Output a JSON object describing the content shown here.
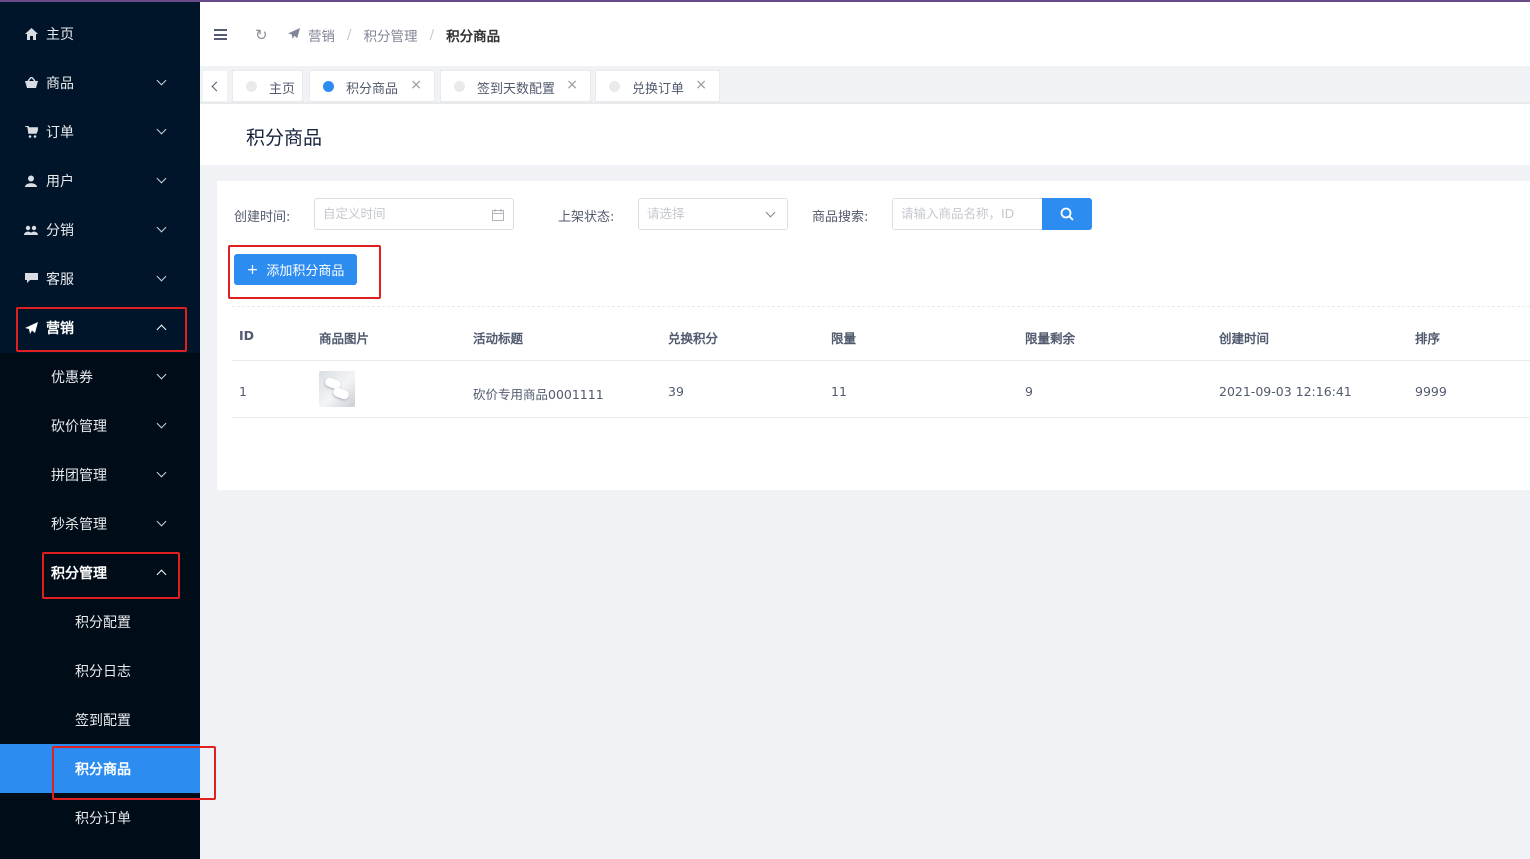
{
  "sidebar": {
    "items": [
      {
        "label": "主页",
        "icon": "home-icon",
        "has_arrow": false
      },
      {
        "label": "商品",
        "icon": "basket-icon",
        "has_arrow": true
      },
      {
        "label": "订单",
        "icon": "cart-icon",
        "has_arrow": true
      },
      {
        "label": "用户",
        "icon": "user-icon",
        "has_arrow": true
      },
      {
        "label": "分销",
        "icon": "group-icon",
        "has_arrow": true
      },
      {
        "label": "客服",
        "icon": "chat-icon",
        "has_arrow": true
      },
      {
        "label": "营销",
        "icon": "send-icon",
        "has_arrow": true,
        "expanded": true
      }
    ],
    "marketing_sub": [
      {
        "label": "优惠券"
      },
      {
        "label": "砍价管理"
      },
      {
        "label": "拼团管理"
      },
      {
        "label": "秒杀管理"
      },
      {
        "label": "积分管理",
        "expanded": true
      }
    ],
    "points_sub": [
      {
        "label": "积分配置"
      },
      {
        "label": "积分日志"
      },
      {
        "label": "签到配置"
      },
      {
        "label": "积分商品",
        "selected": true
      },
      {
        "label": "积分订单"
      }
    ]
  },
  "header": {
    "breadcrumb": [
      "营销",
      "积分管理",
      "积分商品"
    ],
    "separator": "/"
  },
  "tabs": [
    {
      "label": "主页",
      "active": false,
      "closable": false
    },
    {
      "label": "积分商品",
      "active": true,
      "closable": true
    },
    {
      "label": "签到天数配置",
      "active": false,
      "closable": true
    },
    {
      "label": "兑换订单",
      "active": false,
      "closable": true
    }
  ],
  "page": {
    "title": "积分商品"
  },
  "filters": {
    "created_time_label": "创建时间:",
    "created_time_placeholder": "自定义时间",
    "status_label": "上架状态:",
    "status_placeholder": "请选择",
    "search_label": "商品搜索:",
    "search_placeholder": "请输入商品名称，ID"
  },
  "add_button": {
    "label": "添加积分商品",
    "icon": "plus-icon"
  },
  "table": {
    "columns": [
      "ID",
      "商品图片",
      "活动标题",
      "兑换积分",
      "限量",
      "限量剩余",
      "创建时间",
      "排序"
    ],
    "rows": [
      {
        "id": "1",
        "title": "砍价专用商品0001111",
        "points": "39",
        "limit": "11",
        "remaining": "9",
        "created": "2021-09-03 12:16:41",
        "sort": "9999"
      }
    ]
  },
  "colors": {
    "sidebar_bg": "#001529",
    "submenu_bg": "#000c17",
    "primary": "#2d8cf0",
    "highlight_box": "#e02020"
  }
}
